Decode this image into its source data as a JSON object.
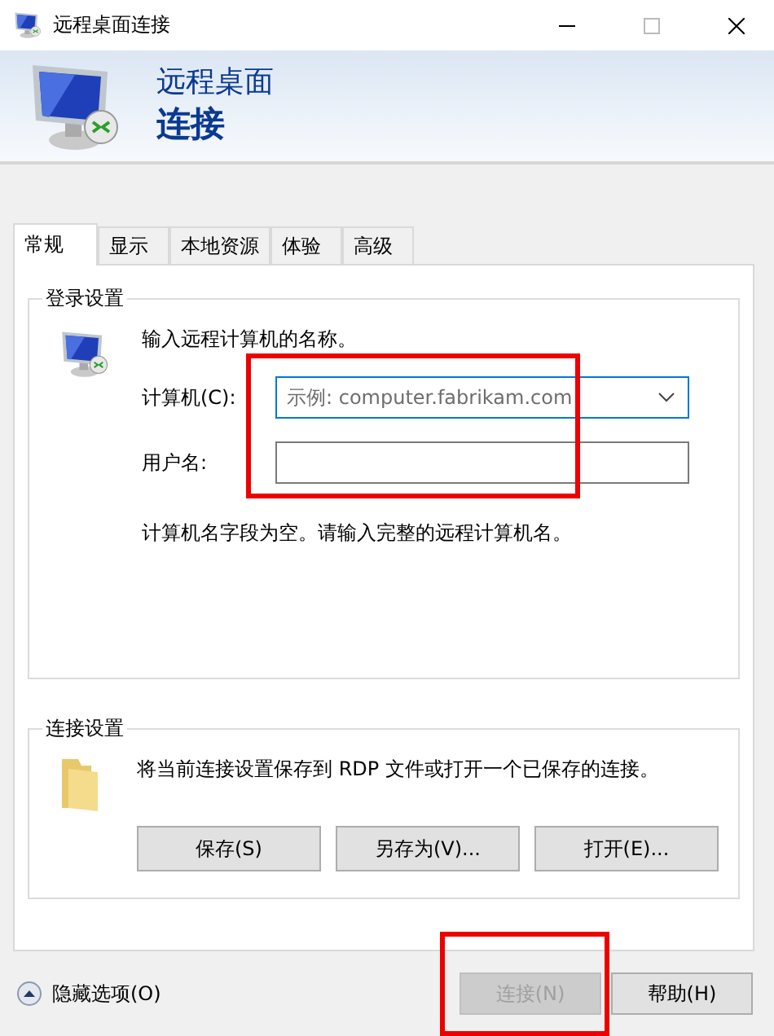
{
  "window": {
    "title": "远程桌面连接"
  },
  "banner": {
    "line1": "远程桌面",
    "line2": "连接"
  },
  "tabs": [
    {
      "label": "常规",
      "selected": true
    },
    {
      "label": "显示",
      "selected": false
    },
    {
      "label": "本地资源",
      "selected": false
    },
    {
      "label": "体验",
      "selected": false
    },
    {
      "label": "高级",
      "selected": false
    }
  ],
  "login_settings": {
    "title": "登录设置",
    "prompt": "输入远程计算机的名称。",
    "fields": [
      {
        "label": "计算机(C):",
        "placeholder": "示例: computer.fabrikam.com",
        "kind": "combo",
        "focused": true
      },
      {
        "label": "用户名:",
        "kind": "text",
        "focused": false
      }
    ],
    "message": "计算机名字段为空。请输入完整的远程计算机名。"
  },
  "connection_settings": {
    "title": "连接设置",
    "description": "将当前连接设置保存到 RDP 文件或打开一个已保存的连接。",
    "buttons": [
      {
        "label": "保存(S)"
      },
      {
        "label": "另存为(V)..."
      },
      {
        "label": "打开(E)..."
      }
    ]
  },
  "footer": {
    "toggle": "隐藏选项(O)",
    "buttons": [
      {
        "label": "连接(N)",
        "disabled": true
      },
      {
        "label": "帮助(H)",
        "disabled": false
      }
    ]
  },
  "annotations": [
    {
      "kind": "highlight"
    },
    {
      "kind": "highlight"
    }
  ]
}
